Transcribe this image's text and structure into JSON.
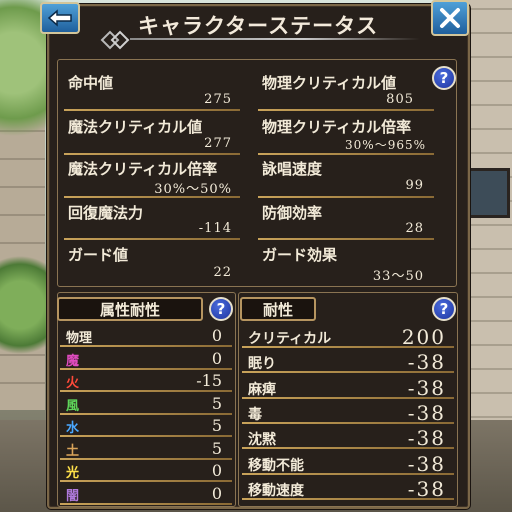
{
  "window": {
    "title": "キャラクターステータス"
  },
  "icons": {
    "back": "back-arrow-icon",
    "close": "close-x-icon",
    "help": "help-question-icon"
  },
  "help_label": "?",
  "stats": [
    {
      "label": "命中値",
      "value": "275"
    },
    {
      "label": "物理クリティカル値",
      "value": "805"
    },
    {
      "label": "魔法クリティカル値",
      "value": "277"
    },
    {
      "label": "物理クリティカル倍率",
      "value": "30%～965%"
    },
    {
      "label": "魔法クリティカル倍率",
      "value": "30%～50%"
    },
    {
      "label": "詠唱速度",
      "value": "99"
    },
    {
      "label": "回復魔法力",
      "value": "-114"
    },
    {
      "label": "防御効率",
      "value": "28"
    },
    {
      "label": "ガード値",
      "value": "22"
    },
    {
      "label": "ガード効果",
      "value": "33～50"
    }
  ],
  "elemental": {
    "header": "属性耐性",
    "rows": [
      {
        "label": "物理",
        "value": "0",
        "color": "#f2ead8"
      },
      {
        "label": "魔",
        "value": "0",
        "color": "#e04cc0"
      },
      {
        "label": "火",
        "value": "-15",
        "color": "#ff4a3a"
      },
      {
        "label": "風",
        "value": "5",
        "color": "#5fd65a"
      },
      {
        "label": "水",
        "value": "5",
        "color": "#4aa8ff"
      },
      {
        "label": "土",
        "value": "5",
        "color": "#d9a45a"
      },
      {
        "label": "光",
        "value": "0",
        "color": "#ffe14a"
      },
      {
        "label": "闇",
        "value": "0",
        "color": "#b07adc"
      }
    ]
  },
  "status": {
    "header": "耐性",
    "rows": [
      {
        "label": "クリティカル",
        "value": "200"
      },
      {
        "label": "眠り",
        "value": "-38"
      },
      {
        "label": "麻痺",
        "value": "-38"
      },
      {
        "label": "毒",
        "value": "-38"
      },
      {
        "label": "沈黙",
        "value": "-38"
      },
      {
        "label": "移動不能",
        "value": "-38"
      },
      {
        "label": "移動速度",
        "value": "-38"
      }
    ]
  }
}
